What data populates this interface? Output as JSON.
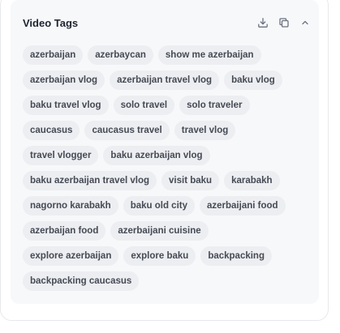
{
  "panel": {
    "title": "Video Tags",
    "actions": {
      "download_icon": "download-icon",
      "copy_icon": "copy-icon",
      "collapse_icon": "chevron-up-icon"
    }
  },
  "tags": [
    "azerbaijan",
    "azerbaycan",
    "show me azerbaijan",
    "azerbaijan vlog",
    "azerbaijan travel vlog",
    "baku vlog",
    "baku travel vlog",
    "solo travel",
    "solo traveler",
    "caucasus",
    "caucasus travel",
    "travel vlog",
    "travel vlogger",
    "baku azerbaijan vlog",
    "baku azerbaijan travel vlog",
    "visit baku",
    "karabakh",
    "nagorno karabakh",
    "baku old city",
    "azerbaijani food",
    "azerbaijan food",
    "azerbaijani cuisine",
    "explore azerbaijan",
    "explore baku",
    "backpacking",
    "backpacking caucasus"
  ],
  "colors": {
    "panel_bg": "#f7f8fa",
    "tag_bg": "#edeef1",
    "tag_text": "#454a55",
    "title_text": "#1f2430",
    "icon_color": "#6b7180"
  }
}
